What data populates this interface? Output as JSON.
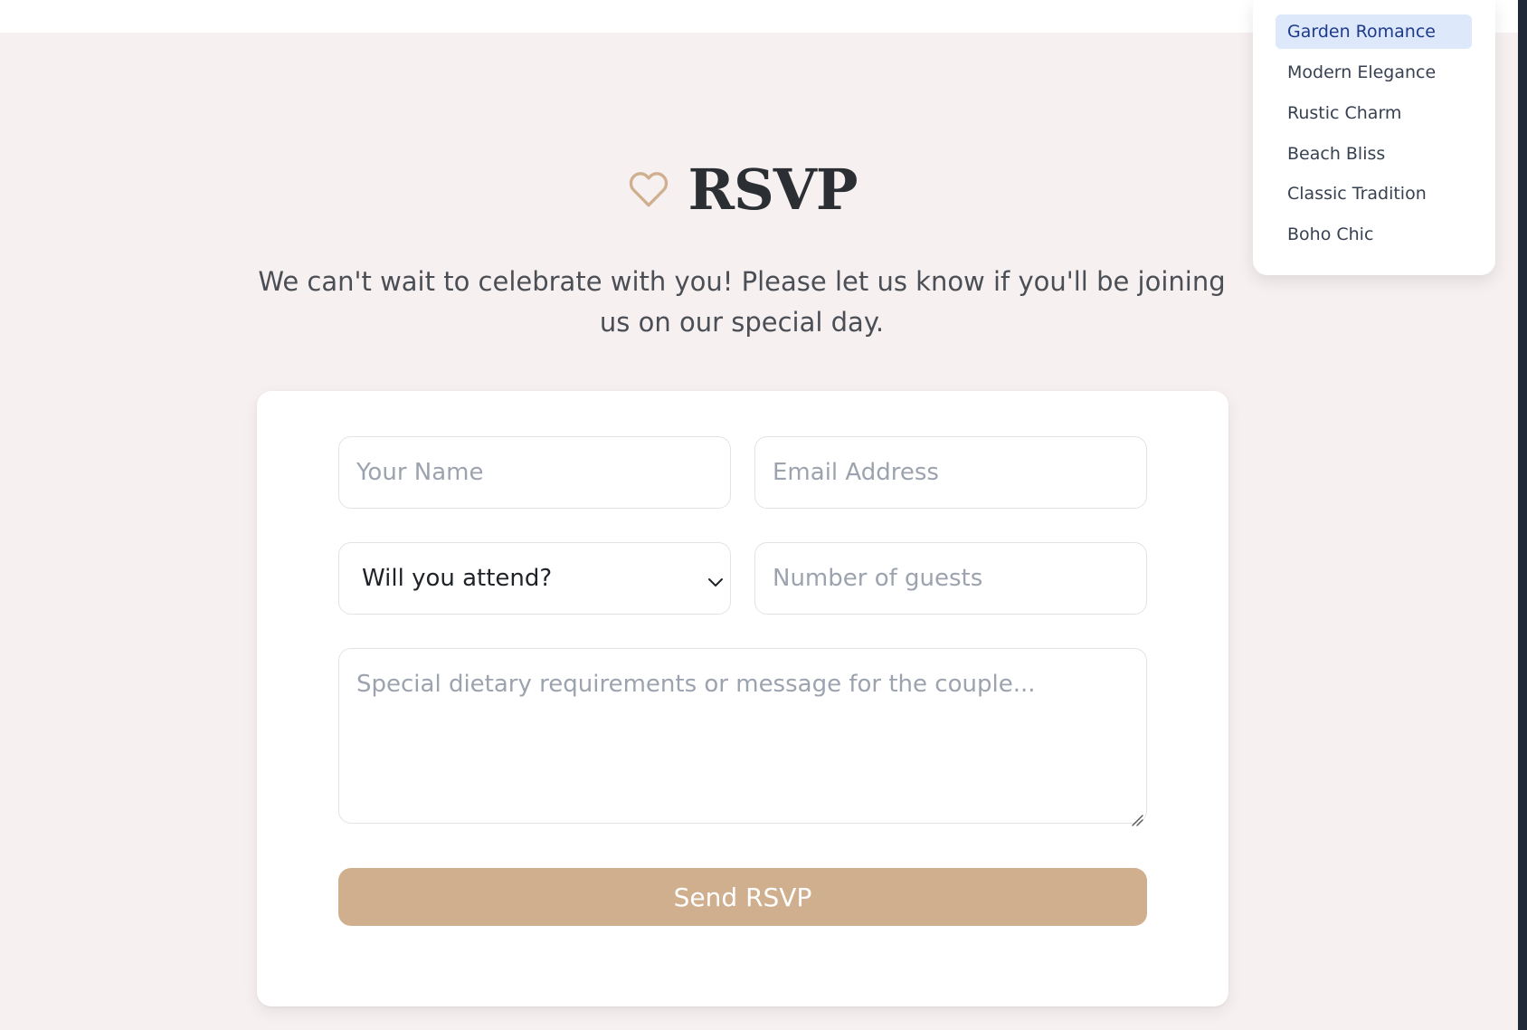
{
  "header": {
    "title": "RSVP",
    "subtitle": "We can't wait to celebrate with you! Please let us know if you'll be joining us on our special day."
  },
  "form": {
    "name_placeholder": "Your Name",
    "email_placeholder": "Email Address",
    "attend_selected": "Will you attend?",
    "guests_placeholder": "Number of guests",
    "message_placeholder": "Special dietary requirements or message for the couple...",
    "submit_label": "Send RSVP"
  },
  "theme_menu": {
    "items": [
      {
        "label": "Garden Romance",
        "selected": true
      },
      {
        "label": "Modern Elegance",
        "selected": false
      },
      {
        "label": "Rustic Charm",
        "selected": false
      },
      {
        "label": "Beach Bliss",
        "selected": false
      },
      {
        "label": "Classic Tradition",
        "selected": false
      },
      {
        "label": "Boho Chic",
        "selected": false
      }
    ]
  },
  "colors": {
    "accent": "#cfaf8e",
    "background": "#f6f0f0",
    "heading": "#2b2f33",
    "selected_item_bg": "#dde8fb",
    "selected_item_text": "#1e3a8a"
  },
  "icons": {
    "title_icon": "heart-icon",
    "select_icon": "chevron-down-icon"
  }
}
